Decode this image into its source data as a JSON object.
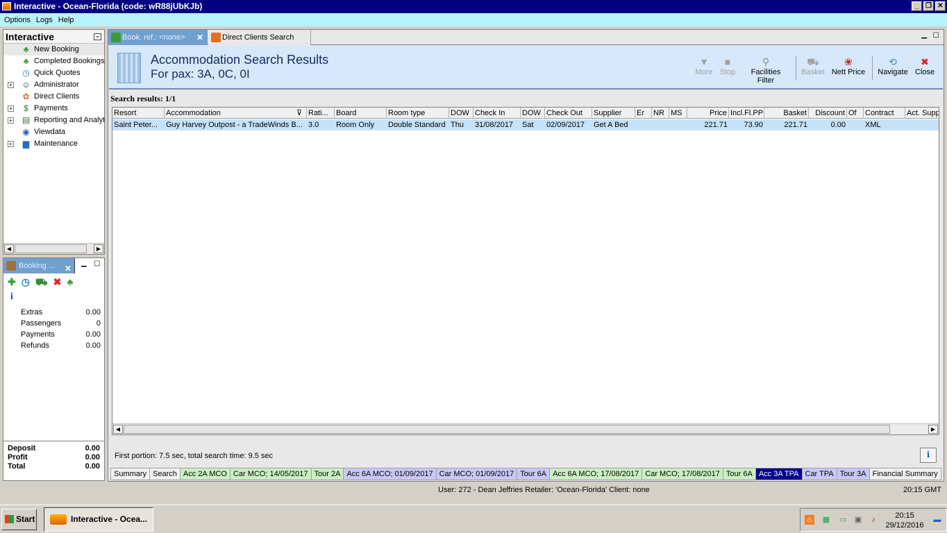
{
  "window": {
    "title": "Interactive - Ocean-Florida (code: wR88jUbKJb)",
    "minimize": "_",
    "restore": "❐",
    "close": "✕"
  },
  "menu": [
    "Options",
    "Logs",
    "Help"
  ],
  "sidebar": {
    "title": "Interactive",
    "items": [
      {
        "label": "New Booking",
        "icon": "palm-tree-icon",
        "expand": ""
      },
      {
        "label": "Completed Bookings",
        "icon": "palm-tree-icon",
        "expand": ""
      },
      {
        "label": "Quick Quotes",
        "icon": "clock-icon",
        "expand": ""
      },
      {
        "label": "Administrator",
        "icon": "person-icon",
        "expand": "+"
      },
      {
        "label": "Direct Clients",
        "icon": "client-icon",
        "expand": ""
      },
      {
        "label": "Payments",
        "icon": "money-icon",
        "expand": "+"
      },
      {
        "label": "Reporting and Analytics",
        "icon": "report-icon",
        "expand": "+"
      },
      {
        "label": "Viewdata",
        "icon": "globe-icon",
        "expand": ""
      },
      {
        "label": "Maintenance",
        "icon": "toolbox-icon",
        "expand": "+"
      }
    ]
  },
  "booking_panel": {
    "tab_label": "Booking ...",
    "rows": [
      {
        "label": "Extras",
        "value": "0.00"
      },
      {
        "label": "Passengers",
        "value": "0"
      },
      {
        "label": "Payments",
        "value": "0.00"
      },
      {
        "label": "Refunds",
        "value": "0.00"
      }
    ],
    "totals": [
      {
        "label": "Deposit",
        "value": "0.00"
      },
      {
        "label": "Profit",
        "value": "0.00"
      },
      {
        "label": "Total",
        "value": "0.00"
      }
    ],
    "info": "i"
  },
  "tabs": {
    "active": "Book. ref.: <none>",
    "other": "Direct Clients Search"
  },
  "header": {
    "title": "Accommodation Search Results",
    "subtitle": "For pax: 3A, 0C, 0I",
    "toolbar": {
      "more": "More",
      "stop": "Stop",
      "facilities": "Facilities Filter",
      "basket": "Basket",
      "nett": "Nett Price",
      "navigate": "Navigate",
      "close": "Close"
    }
  },
  "results_label": "Search results: 1/1",
  "grid": {
    "columns": [
      "Resort",
      "Accommodation",
      "Rati...",
      "Board",
      "Room type",
      "DOW",
      "Check In",
      "DOW",
      "Check Out",
      "Supplier",
      "Er",
      "NR",
      "MS",
      "Price",
      "Incl.Fl.PP",
      "Basket",
      "Discount",
      "Of",
      "Contract",
      "Act. Supp"
    ],
    "rows": [
      [
        "Saint Peter...",
        "Guy Harvey Outpost - a TradeWinds B...",
        "3.0",
        "Room Only",
        "Double Standard",
        "Thu",
        "31/08/2017",
        "Sat",
        "02/09/2017",
        "Get A Bed",
        "",
        "",
        "",
        "221.71",
        "73.90",
        "221.71",
        "0.00",
        "",
        "XML",
        ""
      ]
    ]
  },
  "timing": "First portion: 7.5 sec, total search time: 9.5 sec",
  "bottom_tabs": [
    {
      "label": "Summary",
      "style": "plain"
    },
    {
      "label": "Search",
      "style": "plain"
    },
    {
      "label": "Acc 2A MCO",
      "style": "green"
    },
    {
      "label": "Car MCO; 14/05/2017",
      "style": "green"
    },
    {
      "label": "Tour 2A",
      "style": "green"
    },
    {
      "label": "Acc 6A MCO; 01/09/2017",
      "style": "blue"
    },
    {
      "label": "Car MCO; 01/09/2017",
      "style": "blue"
    },
    {
      "label": "Tour 6A",
      "style": "blue"
    },
    {
      "label": "Acc 6A MCO; 17/08/2017",
      "style": "green"
    },
    {
      "label": "Car MCO; 17/08/2017",
      "style": "green"
    },
    {
      "label": "Tour 6A",
      "style": "green"
    },
    {
      "label": "Acc 3A TPA",
      "style": "active"
    },
    {
      "label": "Car TPA",
      "style": "blue"
    },
    {
      "label": "Tour 3A",
      "style": "blue"
    },
    {
      "label": "Financial Summary",
      "style": "plain"
    }
  ],
  "status": {
    "user": "User: 272 - Dean Jeffries    Retailer: 'Ocean-Florida'    Client: none",
    "time": "20:15 GMT"
  },
  "taskbar": {
    "start": "Start",
    "task": "Interactive - Ocea...",
    "clock_time": "20:15",
    "clock_date": "29/12/2016"
  }
}
